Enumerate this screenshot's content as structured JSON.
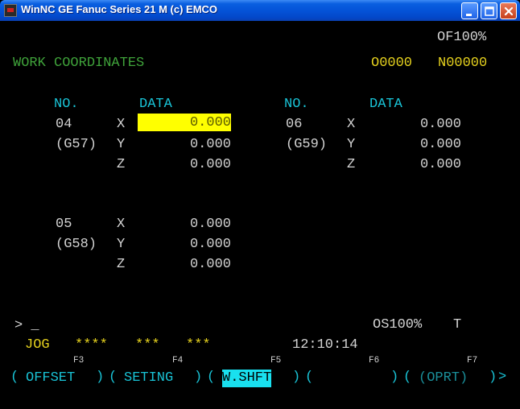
{
  "window": {
    "title": "WinNC GE Fanuc Series 21 M (c) EMCO"
  },
  "status": {
    "feed_override": "OF100%",
    "program_no": "O0000",
    "sequence_no": "N00000",
    "spindle_override": "OS100%",
    "tool": "T",
    "mode": "JOG",
    "indicator_1": "****",
    "indicator_2": "***",
    "indicator_3": "***",
    "clock": "12:10:14",
    "prompt": "> _"
  },
  "screen": {
    "title": "WORK COORDINATES",
    "header_no": "NO.",
    "header_data": "DATA"
  },
  "coordinates": {
    "left": [
      {
        "no": "04",
        "code": "(G57)",
        "x": "0.000",
        "y": "0.000",
        "z": "0.000"
      },
      {
        "no": "05",
        "code": "(G58)",
        "x": "0.000",
        "y": "0.000",
        "z": "0.000"
      }
    ],
    "right": [
      {
        "no": "06",
        "code": "(G59)",
        "x": "0.000",
        "y": "0.000",
        "z": "0.000"
      }
    ],
    "axis_x": "X",
    "axis_y": "Y",
    "axis_z": "Z"
  },
  "softkeys": {
    "f3": "F3",
    "f4": "F4",
    "f5": "F5",
    "f6": "F6",
    "f7": "F7",
    "offset": "OFFSET",
    "seting": "SETING",
    "wshft": "W.SHFT",
    "blank": "",
    "oprt": "(OPRT)",
    "next": ">"
  },
  "colors": {
    "background": "#000000",
    "cyan": "#19c3d6",
    "green": "#3fa23a",
    "yellow": "#e6d21e",
    "highlight": "#ffff00"
  }
}
